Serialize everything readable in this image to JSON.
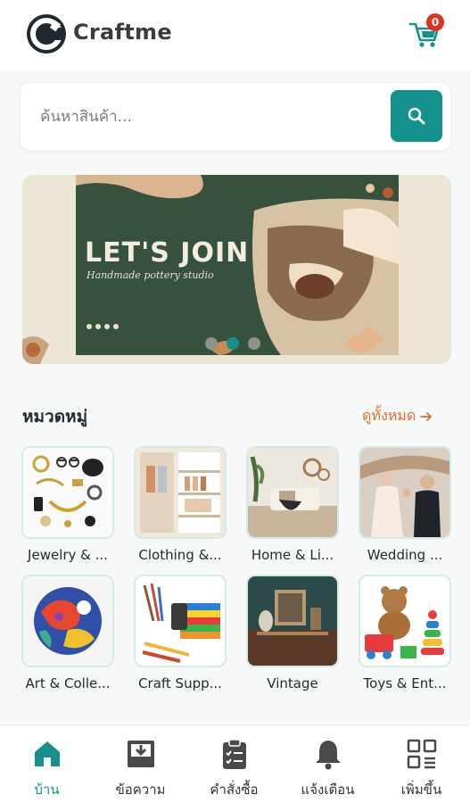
{
  "app": {
    "brand": "Craftme",
    "cart_count": "0"
  },
  "search": {
    "placeholder": "ค้นหาสินค้า..."
  },
  "banner": {
    "title": "LET'S JOIN",
    "subtitle": "Handmade pottery studio",
    "slides": 3,
    "active_slide": 2
  },
  "categories": {
    "title": "หมวดหมู่",
    "see_all": "ดูทั้งหมด",
    "items": [
      {
        "label": "Jewelry & ..."
      },
      {
        "label": "Clothing &..."
      },
      {
        "label": "Home & Li..."
      },
      {
        "label": "Wedding ..."
      },
      {
        "label": "Art & Colle..."
      },
      {
        "label": "Craft Supp..."
      },
      {
        "label": "Vintage"
      },
      {
        "label": "Toys & Ent..."
      }
    ]
  },
  "nav": {
    "items": [
      {
        "label": "บ้าน",
        "icon": "home-icon",
        "active": true
      },
      {
        "label": "ข้อความ",
        "icon": "inbox-icon",
        "active": false
      },
      {
        "label": "คำสั่งซื้อ",
        "icon": "clipboard-icon",
        "active": false
      },
      {
        "label": "แจ้งเตือน",
        "icon": "bell-icon",
        "active": false
      },
      {
        "label": "เพิ่มขึ้น",
        "icon": "grid-menu-icon",
        "active": false
      }
    ]
  },
  "colors": {
    "accent": "#14918c",
    "link": "#d9702a",
    "badge": "#e0301e"
  }
}
